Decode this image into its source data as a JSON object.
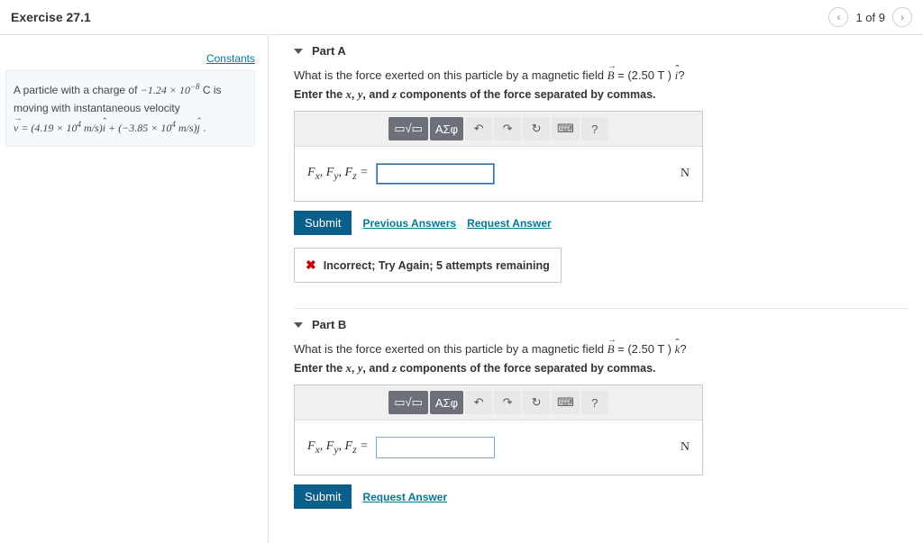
{
  "header": {
    "title": "Exercise 27.1",
    "nav_label": "1 of 9"
  },
  "left": {
    "constants_link": "Constants",
    "problem_line1_a": "A particle with a charge of ",
    "problem_charge": "−1.24 × 10",
    "problem_charge_exp": "−8",
    "problem_line1_b": " C is moving with instantaneous velocity",
    "vel_prefix": " = (4.19 × 10",
    "vel_exp1": "4",
    "vel_mid": " m/s)",
    "vel_plus": " + (−3.85 × 10",
    "vel_exp2": "4",
    "vel_end": " m/s)",
    "vel_period": " ."
  },
  "toolbar": {
    "templates": "▭√▭",
    "greek": "ΑΣφ",
    "undo": "↶",
    "redo": "↷",
    "reset": "↻",
    "keyboard": "⌨",
    "help": "?"
  },
  "partA": {
    "title": "Part A",
    "q_prefix": "What is the force exerted on this particle by a magnetic field ",
    "q_field": " = (2.50  T ) ",
    "q_dir": "î",
    "q_suffix": "?",
    "instr_a": "Enter the ",
    "instr_x": "x",
    "instr_b": ", ",
    "instr_y": "y",
    "instr_c": ", and ",
    "instr_z": "z",
    "instr_d": " components of the force separated by commas.",
    "lhs": "F",
    "unit": "N",
    "submit": "Submit",
    "prev": "Previous Answers",
    "req": "Request Answer",
    "feedback": "Incorrect; Try Again; 5 attempts remaining",
    "input_value": ""
  },
  "partB": {
    "title": "Part B",
    "q_prefix": "What is the force exerted on this particle by a magnetic field ",
    "q_field": " = (2.50  T ) ",
    "q_dir": "k̂",
    "q_suffix": "?",
    "instr_a": "Enter the ",
    "instr_x": "x",
    "instr_b": ", ",
    "instr_y": "y",
    "instr_c": ", and ",
    "instr_z": "z",
    "instr_d": " components of the force separated by commas.",
    "lhs": "F",
    "unit": "N",
    "submit": "Submit",
    "req": "Request Answer",
    "input_value": ""
  }
}
